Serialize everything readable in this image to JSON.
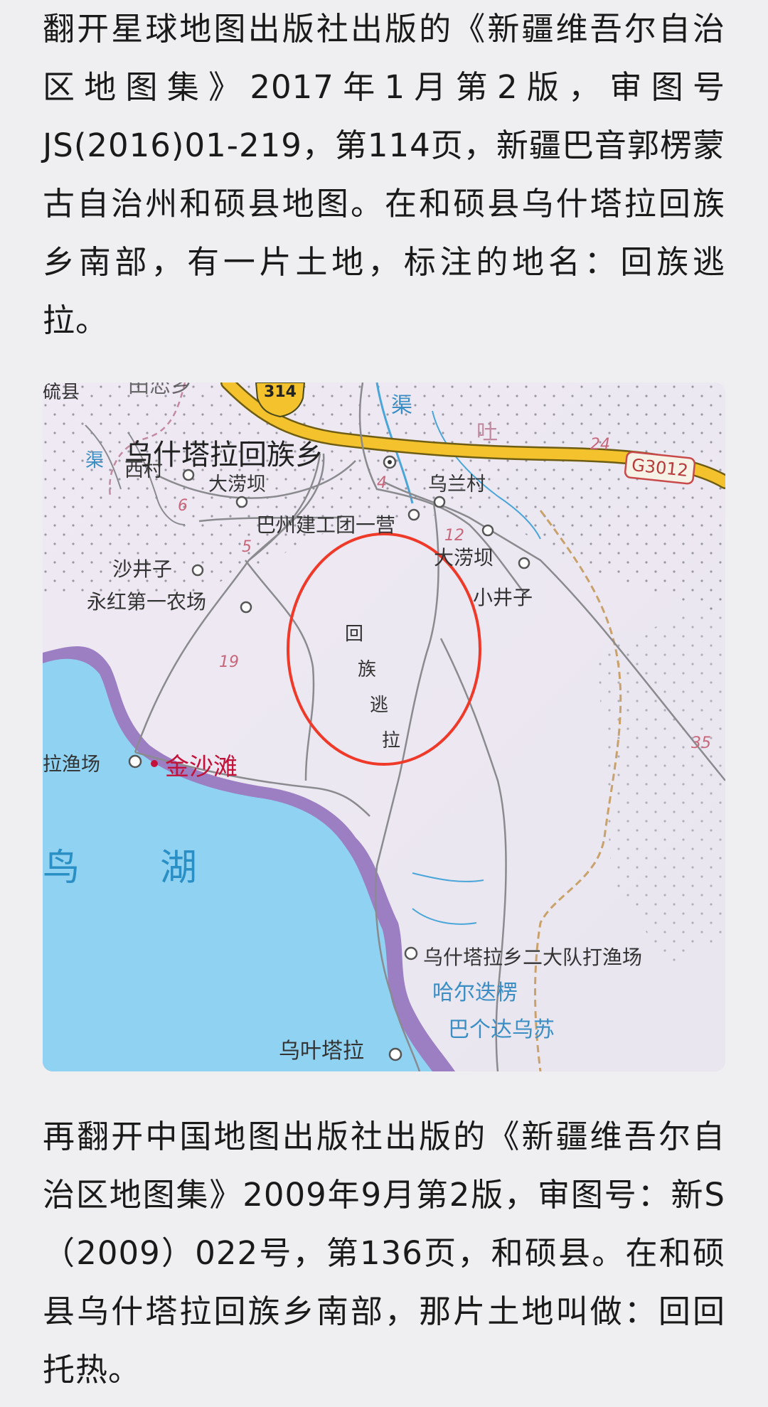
{
  "article": {
    "paragraph_1": "翻开星球地图出版社出版的《新疆维吾尔自治区地图集》2017年1月第2版，审图号JS(2016)01-219，第114页，新疆巴音郭楞蒙古自治州和硕县地图。在和硕县乌什塔拉回族乡南部，有一片土地，标注的地名：回族逃拉。",
    "paragraph_2": "再翻开中国地图出版社出版的《新疆维吾尔自治区地图集》2009年9月第2版，审图号：新S（2009）022号，第136页，和硕县。在和硕县乌什塔拉回族乡南部，那片土地叫做：回回托热。"
  },
  "map": {
    "top_left_fragment_1": "硫县",
    "top_left_fragment_2": "田恋乡",
    "highway_314": "314",
    "highway_g3012": "G3012",
    "label_qu": "渠",
    "label_qu_2": "渠",
    "label_tu": "吐",
    "town": "乌什塔拉回族乡",
    "xicun": "西村",
    "dalaoba_1": "大涝坝",
    "wulancun": "乌兰村",
    "bazhou": "巴州建工团一营",
    "dalaoba_2": "大涝坝",
    "shajingzi": "沙井子",
    "xiaojingzi": "小井子",
    "yonghong": "永红第一农场",
    "circled_1": "回",
    "circled_2": "族",
    "circled_3": "逃",
    "circled_4": "拉",
    "dayuchang": "拉渔场",
    "jinshatan": "金沙滩",
    "lake_1": "鸟",
    "lake_2": "湖",
    "wushitala_team": "乌什塔拉乡二大队打渔场",
    "haerdi": "哈尔迭楞",
    "bagedawusu": "巴个达乌苏",
    "wushitala": "乌叶塔拉",
    "km_4": "4",
    "km_5": "5",
    "km_6": "6",
    "km_12": "12",
    "km_19": "19",
    "km_24": "24",
    "km_35": "35",
    "colors": {
      "lake": "#8fd0f1",
      "lake_shore": "#9b7cc0",
      "road": "#888888",
      "highway": "#f3c22c",
      "circle": "#ef3a2a",
      "jinshatan": "#c2123a",
      "km_marker": "#c8667a"
    }
  }
}
